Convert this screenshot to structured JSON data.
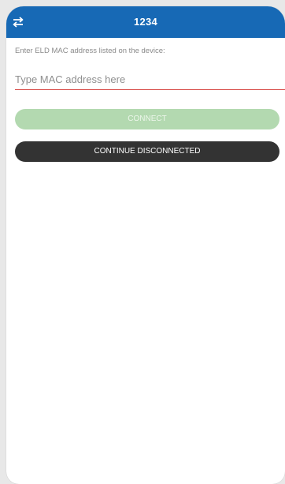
{
  "header": {
    "title": "1234",
    "swap_icon": "swap-arrows-icon",
    "background_color": "#1769b5"
  },
  "form": {
    "instruction": "Enter ELD MAC address listed on the device:",
    "mac_input": {
      "value": "",
      "placeholder": "Type MAC address here"
    }
  },
  "buttons": {
    "connect_label": "CONNECT",
    "connect_color": "#b3d9b0",
    "continue_disconnected_label": "CONTINUE DISCONNECTED",
    "continue_disconnected_color": "#333333"
  }
}
